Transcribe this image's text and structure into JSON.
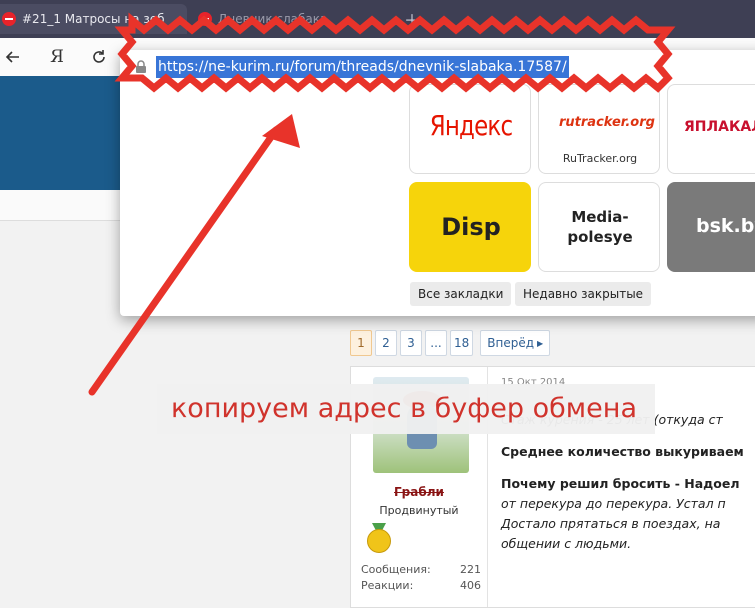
{
  "tabs": [
    {
      "title": "#21_1 Матросы на зеб"
    },
    {
      "title": "Дневник слабака"
    }
  ],
  "toolbar": {
    "yandex_glyph": "Я",
    "back_icon": "arrow-left-icon",
    "reload_icon": "reload-icon"
  },
  "omnibox": {
    "url": "https://ne-kurim.ru/forum/threads/dnevnik-slabaka.17587/"
  },
  "tiles": [
    {
      "name": "Яндекс",
      "caption": ""
    },
    {
      "name": "rutracker.org",
      "caption": "RuTracker.org"
    },
    {
      "name": "ЯПЛАКАЛ",
      "caption": ""
    },
    {
      "name": "Disp",
      "caption": ""
    },
    {
      "name": "Media-polesye",
      "line1": "Media-",
      "line2": "polesye"
    },
    {
      "name": "bsk.by",
      "caption": ""
    }
  ],
  "chips": {
    "bookmarks": "Все закладки",
    "recent": "Недавно закрытые"
  },
  "pagination": {
    "pages": [
      "1",
      "2",
      "3",
      "...",
      "18"
    ],
    "next": "Вперёд"
  },
  "post": {
    "username": "Грабли",
    "user_title": "Продвинутый",
    "stats": [
      {
        "label": "Сообщения:",
        "value": "221"
      },
      {
        "label": "Реакции:",
        "value": "406"
      }
    ],
    "date": "15 Окт 2014",
    "lines": [
      "Стаж курения - 25 лет (откуда ст",
      "Среднее количество выкуриваем",
      "Почему решил бросить - Надоел",
      "от перекура до перекура. Устал п",
      "Достало прятаться в поездах, на",
      "общении с людьми."
    ]
  },
  "annotation": {
    "caption": "копируем адрес в буфер обмена",
    "color": "#e8332a"
  },
  "colors": {
    "tabbar": "#3e3f54",
    "site_header": "#1b5b8b",
    "selection": "#3875d7"
  }
}
